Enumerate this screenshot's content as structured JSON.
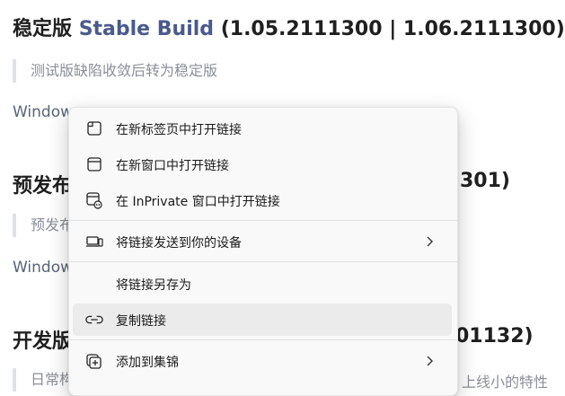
{
  "sections": {
    "stable": {
      "title_zh": "稳定版",
      "title_en": "Stable Build",
      "title_ver": "(1.05.2111300 | 1.06.2111300)",
      "quote": "测试版缺陷收敛后转为稳定版",
      "link_start": "Window"
    },
    "preview": {
      "title_zh_visible": "预发布",
      "title_tail": "301)",
      "quote_visible": "预发布",
      "link_start": "Window"
    },
    "dev": {
      "title_zh_visible": "开发版",
      "title_tail": "01132)",
      "quote_visible": "日常构",
      "quote_tail": "上线小的特性"
    }
  },
  "context_menu": {
    "items": [
      {
        "label": "在新标签页中打开链接",
        "icon": "new-tab-icon"
      },
      {
        "label": "在新窗口中打开链接",
        "icon": "new-window-icon"
      },
      {
        "label": "在 InPrivate 窗口中打开链接",
        "icon": "inprivate-window-icon"
      },
      {
        "label": "将链接发送到你的设备",
        "icon": "send-to-device-icon",
        "submenu": true
      },
      {
        "label": "将链接另存为",
        "icon": null
      },
      {
        "label": "复制链接",
        "icon": "link-icon",
        "hovered": true
      },
      {
        "label": "添加到集锦",
        "icon": "add-to-collections-icon",
        "submenu": true
      }
    ]
  }
}
